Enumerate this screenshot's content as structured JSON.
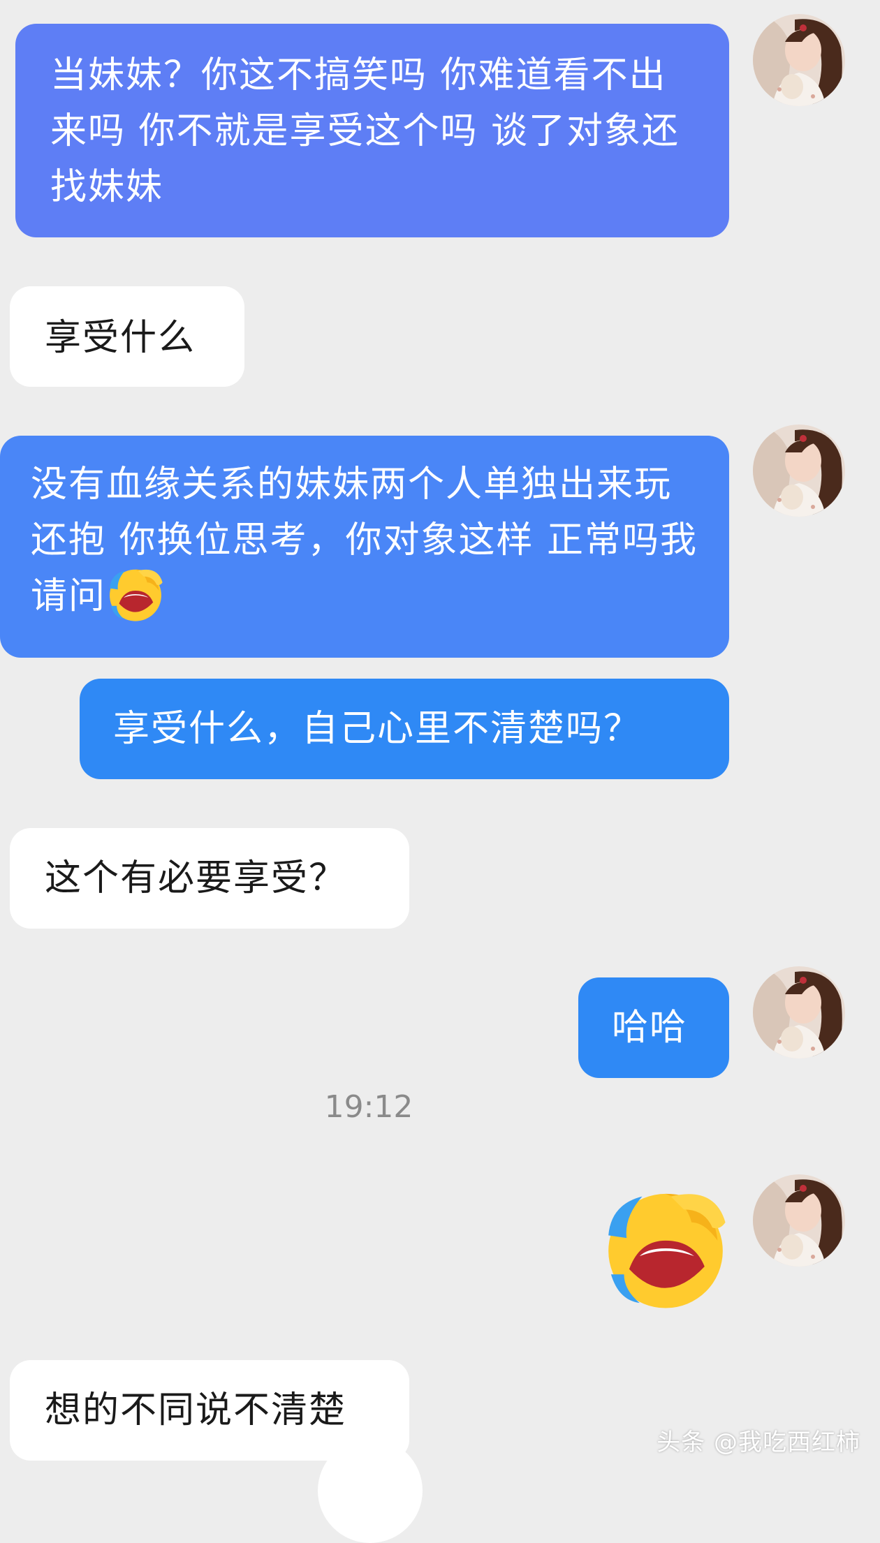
{
  "colors": {
    "background": "#ededed",
    "outgoing_top": "#5e7ef5",
    "outgoing_mid": "#4a86f7",
    "outgoing_blue": "#2f89f5",
    "incoming": "#ffffff"
  },
  "messages": [
    {
      "sender": "me",
      "text": "当妹妹？你这不搞笑吗 你难道看不出来吗 你不就是享受这个吗 谈了对象还找妹妹"
    },
    {
      "sender": "other",
      "text": "享受什么"
    },
    {
      "sender": "me",
      "text": "没有血缘关系的妹妹两个人单独出来玩还抱 你换位思考，你对象这样 正常吗我请问",
      "emoji": "laugh-cry-emoji"
    },
    {
      "sender": "me",
      "text": "享受什么，自己心里不清楚吗？"
    },
    {
      "sender": "other",
      "text": "这个有必要享受？"
    },
    {
      "sender": "me",
      "text": "哈哈"
    },
    {
      "sender": "me",
      "emoji": "laugh-cry-emoji"
    },
    {
      "sender": "other",
      "text": "想的不同说不清楚"
    }
  ],
  "timestamp": "19:12",
  "watermark": "头条 @我吃西红柿"
}
